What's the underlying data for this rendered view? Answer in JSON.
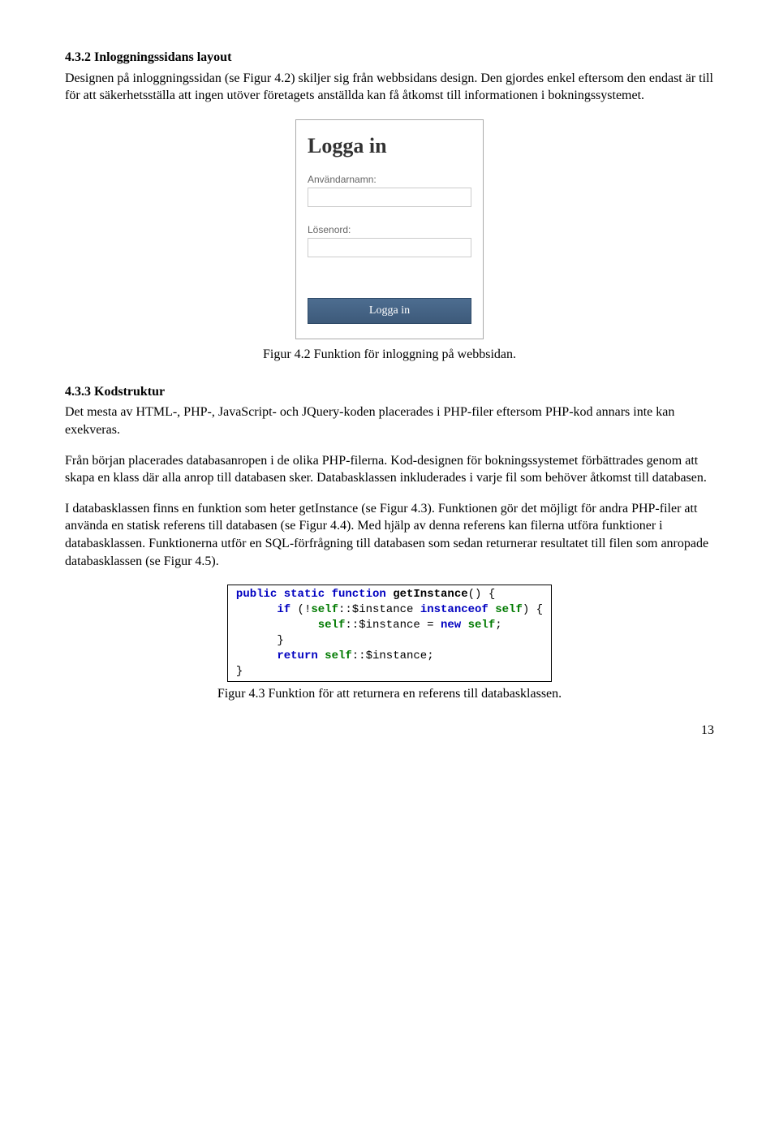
{
  "section_432": {
    "heading": "4.3.2 Inloggningssidans layout",
    "p1": "Designen på inloggningssidan (se Figur 4.2) skiljer sig från webbsidans design. Den gjordes enkel eftersom den endast är till för att säkerhetsställa att ingen utöver företagets anställda kan få åtkomst till informationen i bokningssystemet."
  },
  "login_form": {
    "title": "Logga in",
    "username_label": "Användarnamn:",
    "password_label": "Lösenord:",
    "button_label": "Logga in"
  },
  "figure_42_caption": "Figur 4.2 Funktion för inloggning på webbsidan.",
  "section_433": {
    "heading": "4.3.3 Kodstruktur",
    "p1": "Det mesta av HTML-, PHP-, JavaScript- och JQuery-koden placerades i PHP-filer eftersom PHP-kod annars inte kan exekveras.",
    "p2": "Från början placerades databasanropen i de olika PHP-filerna. Kod-designen för bokningssystemet förbättrades genom att skapa en klass där alla anrop till databasen sker. Databasklassen inkluderades i varje fil som behöver åtkomst till databasen.",
    "p3": "I databasklassen finns en funktion som heter getInstance (se Figur 4.3). Funktionen gör det möjligt för andra PHP-filer att använda en statisk referens till databasen (se Figur 4.4). Med hjälp av denna referens kan filerna utföra funktioner i databasklassen. Funktionerna utför en SQL-förfrågning till databasen som sedan returnerar resultatet till filen som anropade databasklassen (se Figur 4.5)."
  },
  "code": {
    "kw_public": "public",
    "kw_static": "static",
    "kw_function": "function",
    "fn_name": "getInstance",
    "open_paren": "() {",
    "kw_if": "if",
    "cond_open": " (!",
    "self1": "self",
    "inst1": "::$instance ",
    "kw_instanceof": "instanceof",
    "space": " ",
    "self2": "self",
    "cond_close": ") {",
    "self3": "self",
    "inst2": "::$instance = ",
    "kw_new": "new",
    "self4": "self",
    "semicolon": ";",
    "close_brace": "}",
    "kw_return": "return",
    "self5": "self",
    "inst3": "::$instance;",
    "close_brace2": "}"
  },
  "figure_43_caption": "Figur 4.3 Funktion för att returnera en referens till databasklassen.",
  "page_number": "13"
}
